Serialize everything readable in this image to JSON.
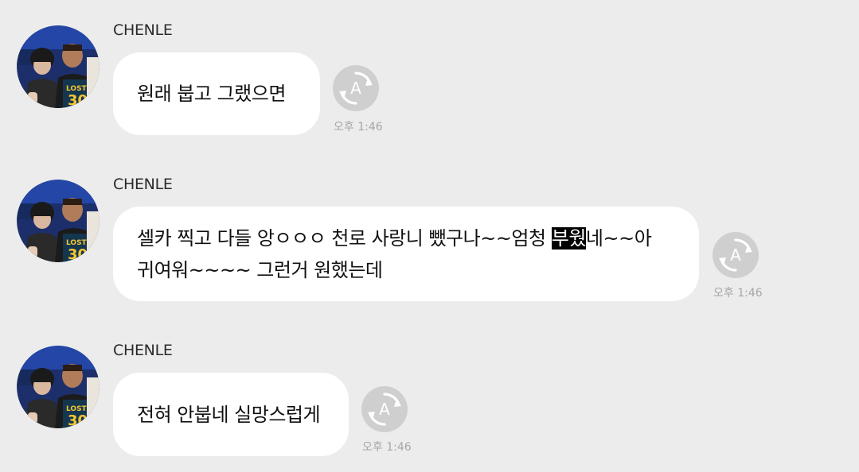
{
  "messages": [
    {
      "sender": "CHENLE",
      "lines": [
        "원래 붑고 그랬으면"
      ],
      "time": "오후 1:46",
      "translate_icon": "translate-icon"
    },
    {
      "sender": "CHENLE",
      "line1_before": "셀카 찍고 다들 앙ㅇㅇㅇ 천로 사랑니 뺐구나~~엄청 ",
      "line1_highlight": "부웠",
      "line1_after": "네~~아",
      "line2": "귀여워~~~~ 그런거 원했는데",
      "time": "오후 1:46",
      "translate_icon": "translate-icon"
    },
    {
      "sender": "CHENLE",
      "lines": [
        "전혀 안붑네 실망스럽게"
      ],
      "time": "오후 1:46",
      "translate_icon": "translate-icon"
    }
  ],
  "colors": {
    "background": "#ececec",
    "bubble": "#ffffff",
    "translate_button": "#cfcfcf",
    "highlight": "#000000"
  }
}
